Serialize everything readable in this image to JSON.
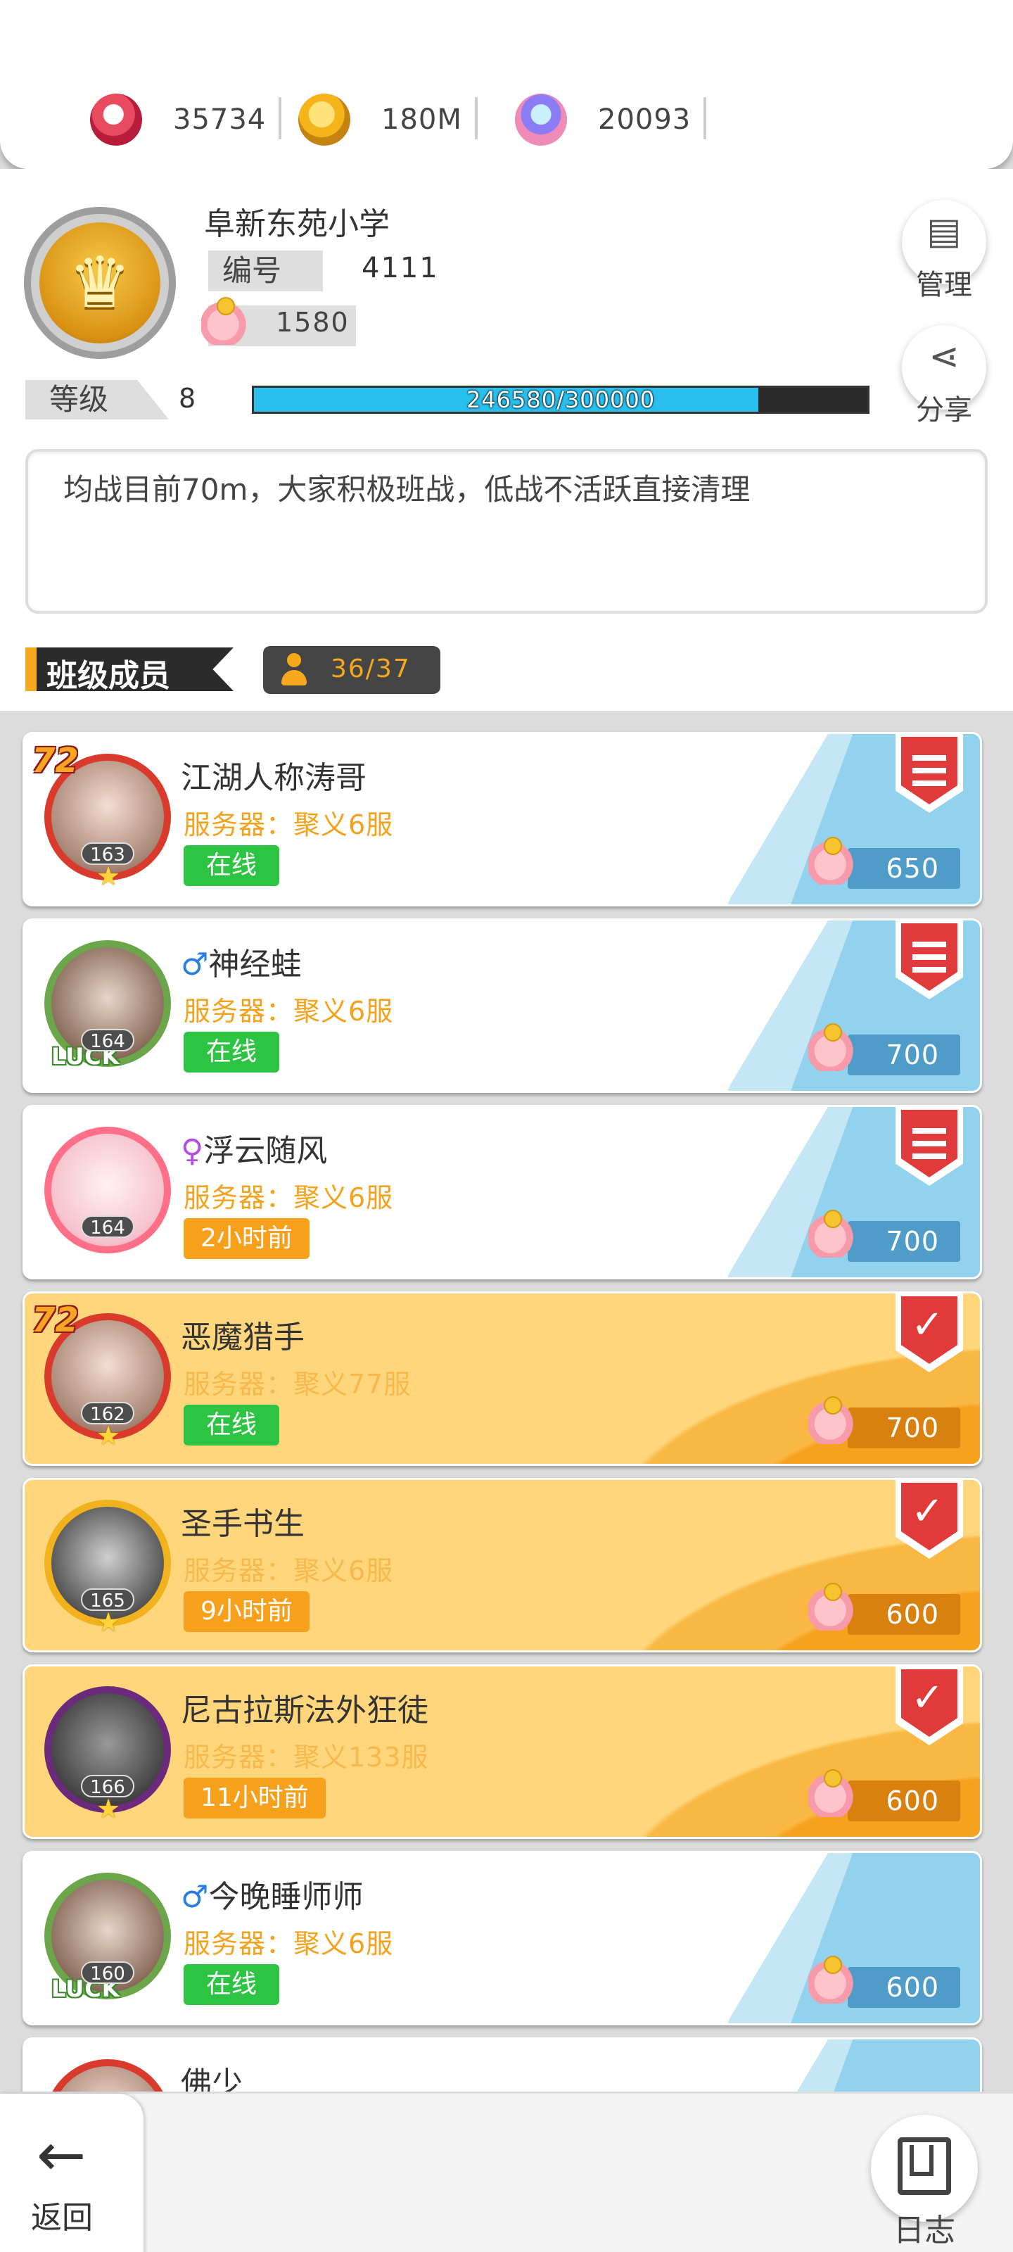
{
  "resources": [
    {
      "icon": "ticket-icon",
      "value": "35734"
    },
    {
      "icon": "coin-icon",
      "value": "180M"
    },
    {
      "icon": "gem-icon",
      "value": "20093"
    }
  ],
  "school": {
    "name": "阜新东苑小学",
    "id_label": "编号",
    "id_value": "4111",
    "pig_value": "1580",
    "level_label": "等级",
    "level_value": "8",
    "progress_text": "246580/300000",
    "progress_fraction": 0.822
  },
  "actions": {
    "manage_label": "管理",
    "share_label": "分享"
  },
  "notice": "均战目前70m，大家积极班战，低战不活跃直接清理",
  "members_section": {
    "title": "班级成员",
    "count": "36/37"
  },
  "members": [
    {
      "name": "江湖人称涛哥",
      "gender": "",
      "server": "服务器：聚义6服",
      "status": "在线",
      "online": true,
      "contribution": "650",
      "level": "163",
      "style": "blue",
      "avatar": "red",
      "badge72": "72",
      "rank": "bars"
    },
    {
      "name": "神经蛙",
      "gender": "♂",
      "server": "服务器：聚义6服",
      "status": "在线",
      "online": true,
      "contribution": "700",
      "level": "164",
      "style": "blue",
      "avatar": "luck",
      "badge72": "",
      "rank": "bars"
    },
    {
      "name": "浮云随风",
      "gender": "♀",
      "server": "服务器：聚义6服",
      "status": "2小时前",
      "online": false,
      "contribution": "700",
      "level": "164",
      "style": "blue",
      "avatar": "pink",
      "badge72": "",
      "rank": "bars"
    },
    {
      "name": "恶魔猎手",
      "gender": "",
      "server": "服务器：聚义77服",
      "status": "在线",
      "online": true,
      "contribution": "700",
      "level": "162",
      "style": "gold",
      "avatar": "red",
      "badge72": "72",
      "rank": "vv"
    },
    {
      "name": "圣手书生",
      "gender": "",
      "server": "服务器：聚义6服",
      "status": "9小时前",
      "online": false,
      "contribution": "600",
      "level": "165",
      "style": "gold",
      "avatar": "ssr",
      "badge72": "",
      "rank": "vv"
    },
    {
      "name": "尼古拉斯法外狂徒",
      "gender": "",
      "server": "服务器：聚义133服",
      "status": "11小时前",
      "online": false,
      "contribution": "600",
      "level": "166",
      "style": "gold",
      "avatar": "devil",
      "badge72": "",
      "rank": "vv"
    },
    {
      "name": "今晚睡师师",
      "gender": "♂",
      "server": "服务器：聚义6服",
      "status": "在线",
      "online": true,
      "contribution": "600",
      "level": "160",
      "style": "blue",
      "avatar": "luck",
      "badge72": "",
      "rank": ""
    },
    {
      "name": "佛少",
      "gender": "",
      "server": "",
      "status": "",
      "online": true,
      "contribution": "",
      "level": "",
      "style": "blue",
      "avatar": "red",
      "badge72": "",
      "rank": ""
    }
  ],
  "bottom_nav": {
    "back_label": "返回",
    "log_label": "日志"
  },
  "colors": {
    "accent_orange": "#f7a81c",
    "online_green": "#2ec443",
    "away_orange": "#f7a01c",
    "progress_blue": "#29c0ee"
  }
}
